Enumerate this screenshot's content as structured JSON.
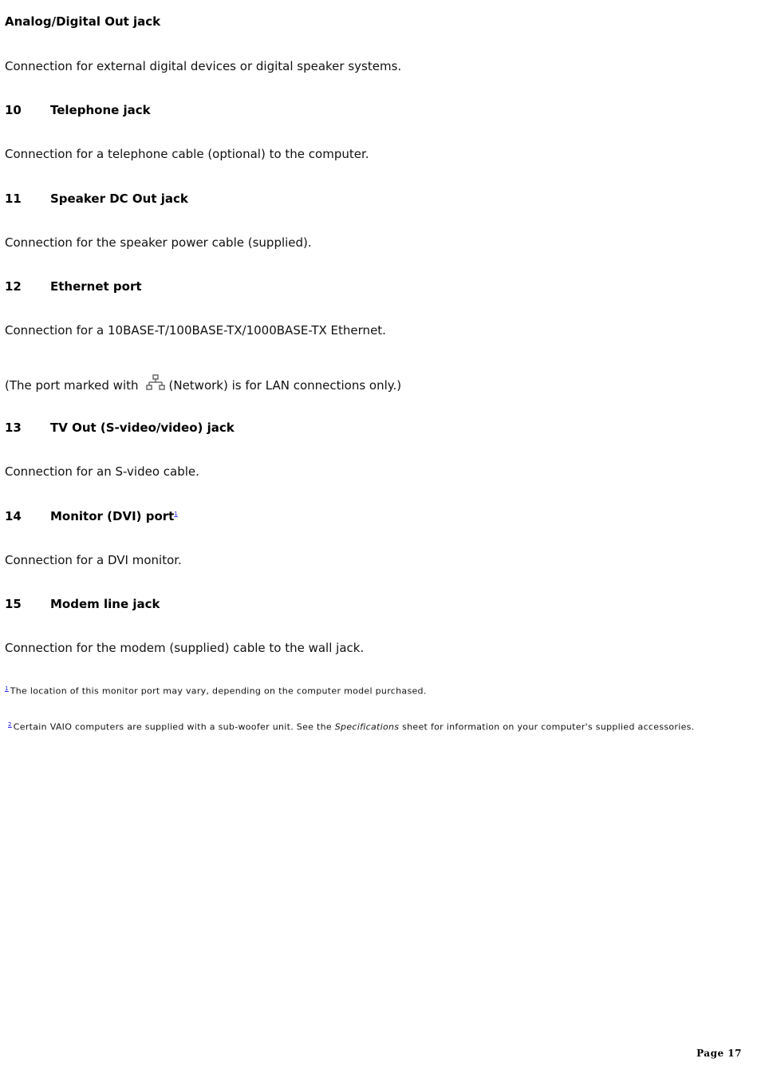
{
  "sections": [
    {
      "number": "",
      "title": "Analog/Digital Out jack",
      "desc": "Connection for external digital devices or digital speaker systems."
    },
    {
      "number": "10",
      "title": "Telephone jack",
      "desc": "Connection for a telephone cable (optional) to the computer."
    },
    {
      "number": "11",
      "title": "Speaker DC Out jack",
      "desc": "Connection for the speaker power cable (supplied)."
    },
    {
      "number": "12",
      "title": "Ethernet port",
      "desc": "Connection for a 10BASE-T/100BASE-TX/1000BASE-TX Ethernet.",
      "note_before": "(The port marked with",
      "note_icon": "network-icon",
      "note_after": "(Network) is for LAN connections only.)"
    },
    {
      "number": "13",
      "title": "TV Out (S-video/video) jack",
      "desc": "Connection for an S-video cable."
    },
    {
      "number": "14",
      "title": "Monitor (DVI) port",
      "footnote_ref": "1",
      "desc": "Connection for a DVI monitor."
    },
    {
      "number": "15",
      "title": "Modem line jack",
      "desc": "Connection for the modem (supplied) cable to the wall jack."
    }
  ],
  "footnotes": [
    {
      "ref": "1",
      "text": "The location of this monitor port may vary, depending on the computer model purchased."
    },
    {
      "ref": "2",
      "text_before": "Certain VAIO computers are supplied with a sub-woofer unit. See the ",
      "italic": "Specifications",
      "text_after": " sheet for information on your computer's supplied accessories."
    }
  ],
  "page_label": "Page 17"
}
